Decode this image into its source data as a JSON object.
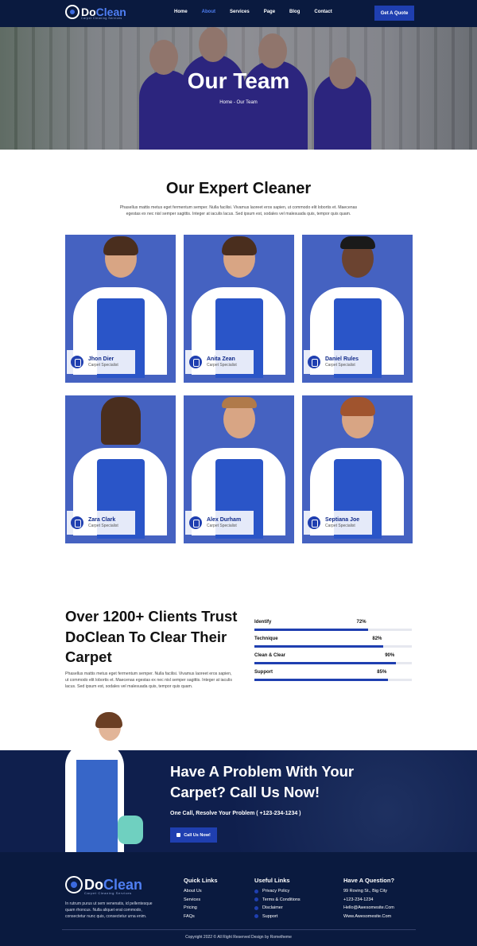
{
  "brand": {
    "name_a": "Do",
    "name_b": "Clean",
    "tagline": "Carpet Cleaning Services"
  },
  "nav": {
    "items": [
      {
        "label": "Home",
        "active": false
      },
      {
        "label": "About",
        "active": true
      },
      {
        "label": "Services",
        "active": false
      },
      {
        "label": "Page",
        "active": false
      },
      {
        "label": "Blog",
        "active": false
      },
      {
        "label": "Contact",
        "active": false
      }
    ],
    "cta": "Get A Quote"
  },
  "hero": {
    "title": "Our Team",
    "breadcrumb": "Home - Our Team"
  },
  "team": {
    "title": "Our Expert Cleaner",
    "description": "Phasellus mattis metus eget fermentum semper. Nulla facilisi. Vivamus laoreet eros sapien, ut commodo elit lobortis et. Maecenas egestas ex nec nisl semper sagittis. Integer at iaculis lacus. Sed ipsum est, sodales vel malesuada quis, tempor quis quam.",
    "members": [
      {
        "name": "Jhon Dier",
        "role": "Carpet Specialist"
      },
      {
        "name": "Anita Zean",
        "role": "Carpet Specialist"
      },
      {
        "name": "Daniel Rules",
        "role": "Carpet Specialist"
      },
      {
        "name": "Zara Clark",
        "role": "Carpet Specialist"
      },
      {
        "name": "Alex Durham",
        "role": "Carpet Specialist"
      },
      {
        "name": "Septiana Joe",
        "role": "Carpet Specialist"
      }
    ]
  },
  "trust": {
    "title": "Over 1200+ Clients Trust DoClean To Clear Their Carpet",
    "description": "Phasellus mattis metus eget fermentum semper. Nulla facilisi. Vivamus laoreet eros sapien, ut commodo elit lobortis et. Maecenas egestas ex nec nisl semper sagittis. Integer at iaculis lacus. Sed ipsum est, sodales vel malesuada quis, tempor quis quam.",
    "skills": [
      {
        "label": "Identify",
        "value": 72,
        "text": "72%"
      },
      {
        "label": "Technique",
        "value": 82,
        "text": "82%"
      },
      {
        "label": "Clean & Clear",
        "value": 90,
        "text": "90%"
      },
      {
        "label": "Support",
        "value": 85,
        "text": "85%"
      }
    ]
  },
  "cta": {
    "title": "Have A Problem With Your Carpet? Call Us Now!",
    "phone_line": "One Call, Resolve Your Problem ( +123-234-1234 )",
    "button": "Call Us Now!"
  },
  "footer": {
    "description": "In rutrum purus ut sem venenatis, id pellentesque quam rhoncus. Nulla aliquet erat commodo, consectetur nunc quis, consectetur urna enim.",
    "quick_links": {
      "title": "Quick Links",
      "items": [
        "About Us",
        "Services",
        "Pricing",
        "FAQs"
      ]
    },
    "useful_links": {
      "title": "Useful Links",
      "items": [
        "Privacy Policy",
        "Terms & Conditions",
        "Disclaimer",
        "Support"
      ]
    },
    "contact": {
      "title": "Have A Question?",
      "items": [
        "99 Roving St., Big City",
        "+123-234-1234",
        "Hello@Awesomesite.Com",
        "Www.Awesomesite.Com"
      ]
    },
    "copyright": "Copyright 2022 © All Right Reserved Design by Rometheme"
  },
  "colors": {
    "navy": "#0a1a3f",
    "accent": "#1f3fb0",
    "card_bg": "#4562c1"
  }
}
